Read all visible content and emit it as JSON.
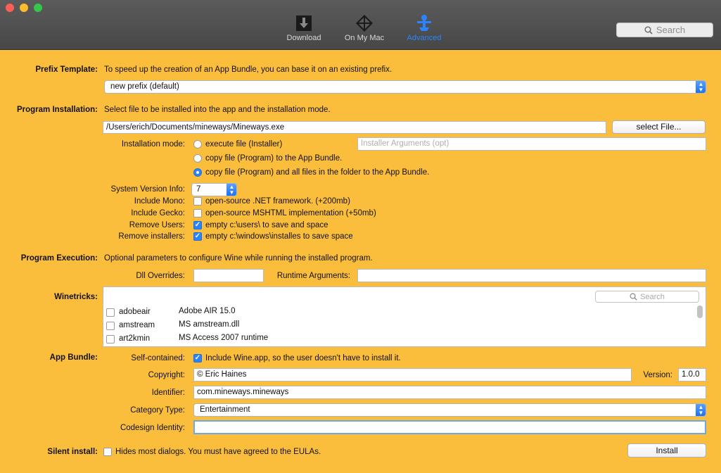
{
  "window": {
    "traffic_colors": [
      "#fc5f57",
      "#fdbc2e",
      "#34c84a"
    ]
  },
  "toolbar": {
    "download": "Download",
    "on_my_mac": "On My Mac",
    "advanced": "Advanced",
    "search_placeholder": "Search"
  },
  "prefix": {
    "label": "Prefix Template:",
    "desc": "To speed up the creation of an App Bundle, you can base it on an existing prefix.",
    "value": "new prefix (default)"
  },
  "program_installation": {
    "label": "Program Installation:",
    "desc": "Select file to be installed into the app and the installation mode.",
    "path": "/Users/erich/Documents/mineways/Mineways.exe",
    "select_file": "select File...",
    "mode_label": "Installation mode:",
    "mode_options": [
      "execute file (Installer)",
      "copy file (Program)  to the App Bundle.",
      "copy file (Program)  and all files in the folder to the App Bundle."
    ],
    "selected_mode": 2,
    "installer_args_placeholder": "Installer Arguments (opt)"
  },
  "options": {
    "system_version_label": "System Version Info:",
    "system_version_value": "7",
    "include_mono_label": "Include Mono:",
    "include_mono_text": "open-source .NET framework. (+200mb)",
    "include_mono": false,
    "include_gecko_label": "Include Gecko:",
    "include_gecko_text": "open-source MSHTML implementation (+50mb)",
    "include_gecko": false,
    "remove_users_label": "Remove Users:",
    "remove_users_text": "empty c:\\users\\ to save and space",
    "remove_users": true,
    "remove_installers_label": "Remove installers:",
    "remove_installers_text": "empty c:\\windows\\installes to save space",
    "remove_installers": true
  },
  "execution": {
    "label": "Program Execution:",
    "desc": "Optional parameters to configure Wine while running the installed program.",
    "dll_label": "Dll Overrides:",
    "dll_value": "",
    "runtime_label": "Runtime Arguments:",
    "runtime_value": ""
  },
  "winetricks": {
    "label": "Winetricks:",
    "search_placeholder": "Search",
    "items": [
      {
        "name": "adobeair",
        "desc": "Adobe AIR 15.0",
        "checked": false
      },
      {
        "name": "amstream",
        "desc": "MS amstream.dll",
        "checked": false
      },
      {
        "name": "art2kmin",
        "desc": "MS Access 2007 runtime",
        "checked": false
      }
    ]
  },
  "app_bundle": {
    "label": "App Bundle:",
    "self_contained_label": "Self-contained:",
    "self_contained_text": "Include Wine.app, so the user doesn't have to install it.",
    "self_contained": true,
    "copyright_label": "Copyright:",
    "copyright_value": "© Eric Haines",
    "version_label": "Version:",
    "version_value": "1.0.0",
    "identifier_label": "Identifier:",
    "identifier_value": "com.mineways.mineways",
    "category_label": "Category Type:",
    "category_value": "Entertainment",
    "codesign_label": "Codesign Identity:",
    "codesign_value": ""
  },
  "silent": {
    "label": "Silent install:",
    "text": "Hides most dialogs. You must have agreed to the EULAs.",
    "checked": false,
    "install_button": "Install"
  }
}
